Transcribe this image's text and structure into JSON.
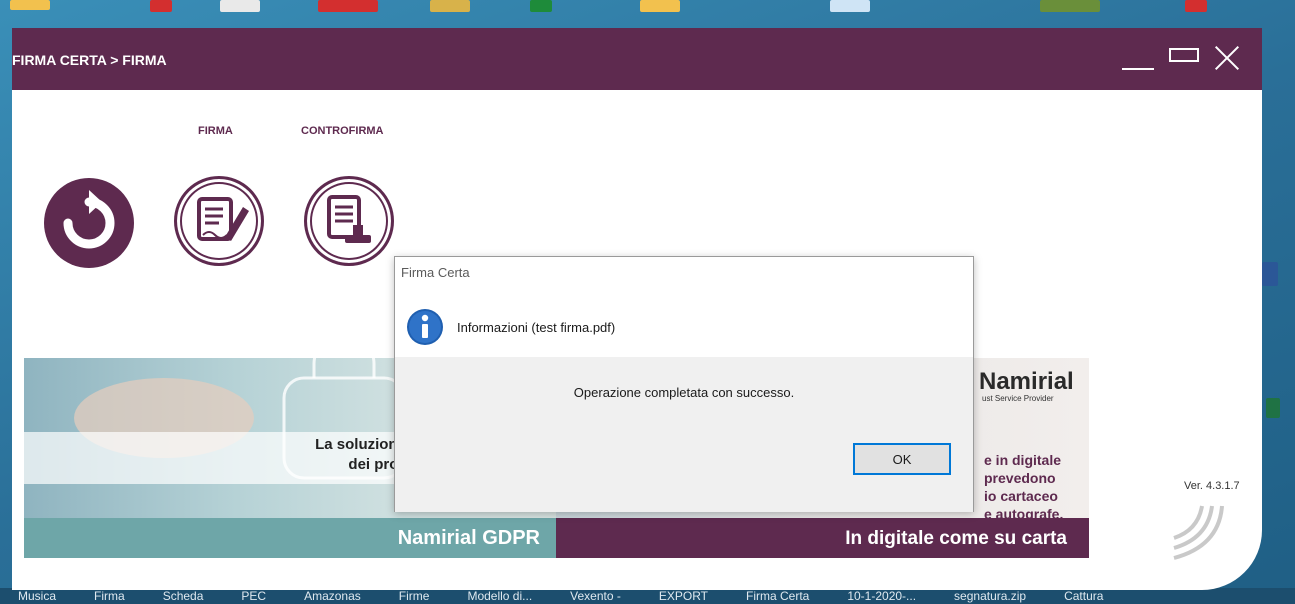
{
  "window": {
    "title": "FIRMA CERTA > FIRMA"
  },
  "toolbar": {
    "firma_label": "FIRMA",
    "controfirma_label": "CONTROFIRMA",
    "refresh_icon": "refresh-icon",
    "firma_icon": "document-pen-icon",
    "controfirma_icon": "document-stamp-icon"
  },
  "banner": {
    "line1": "La soluzione dinamica per gestire",
    "line2": "dei professionisti e delle azie",
    "logo": "Namirial",
    "logo_sub": "ust Service Provider",
    "right_line1": "e in digitale",
    "right_line2": "prevedono",
    "right_line3": "io cartaceo",
    "right_line4": "e autografe.",
    "bar_left": "Namirial GDPR",
    "bar_right": "In digitale come su carta"
  },
  "version": "Ver. 4.3.1.7",
  "dialog": {
    "title": "Firma Certa",
    "heading": "Informazioni (test firma.pdf)",
    "message": "Operazione completata con successo.",
    "ok_label": "OK"
  },
  "taskbar": {
    "items": [
      "Musica",
      "Firma",
      "Scheda",
      "PEC",
      "Amazonas",
      "Firme",
      "Modello di...",
      "Vexento -",
      "EXPORT",
      "Firma Certa",
      "10-1-2020-...",
      "segnatura.zip",
      "Cattura"
    ]
  },
  "colors": {
    "brand": "#5e2a4f",
    "teal": "#6ea6a8",
    "dialog_accent": "#0078d7"
  }
}
